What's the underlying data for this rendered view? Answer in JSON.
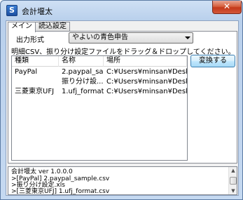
{
  "window": {
    "title": "会計堰太",
    "app_icon_letter": "S",
    "close_symbol": "✕"
  },
  "tabs": [
    {
      "label": "メイン",
      "active": true
    },
    {
      "label": "読込設定",
      "active": false
    }
  ],
  "main": {
    "output_format_label": "出力形式",
    "output_format_value": "やよいの青色申告",
    "instruction": "明細CSV、振り分け設定ファイルをドラッグ＆ドロップしてください。",
    "convert_button": "変換する",
    "table": {
      "headers": [
        "種類",
        "名称",
        "場所"
      ],
      "rows": [
        [
          "PayPal",
          "2.paypal_sa...",
          "C:¥Users¥minsan¥Desk..."
        ],
        [
          "",
          "振り分け設...",
          "C:¥Users¥minsan¥Desk..."
        ],
        [
          "三菱東京UFJ",
          "1.ufj_format...",
          "C:¥Users¥minsan¥Desk..."
        ]
      ]
    }
  },
  "log": {
    "lines": [
      "会計堰太 ver 1.0.0.0",
      ">[PayPal] 2.paypal_sample.csv",
      ">振り分け設定.xls",
      ">[三菱東京UFJ] 1.ufj_format.csv"
    ],
    "scroll_up": "▲",
    "scroll_down": "▼"
  }
}
